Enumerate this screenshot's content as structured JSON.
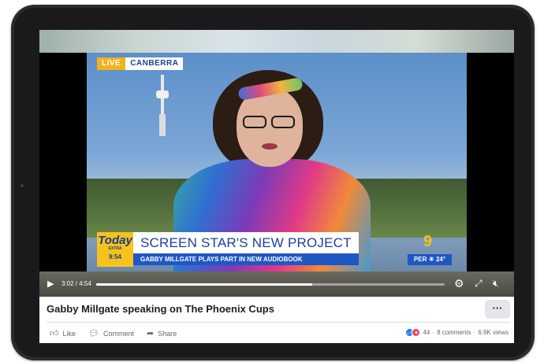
{
  "video": {
    "live_label": "LIVE",
    "location": "CANBERRA",
    "show_logo": "Today",
    "show_logo_sub": "EXTRA",
    "show_time": "9:54",
    "headline": "SCREEN STAR'S NEW PROJECT",
    "subheadline": "GABBY MILLGATE PLAYS PART IN NEW AUDIOBOOK",
    "channel_logo": "9",
    "weather": "PER ☀ 24°",
    "time_display": "3:02 / 4:54",
    "progress": 0.62
  },
  "icons": {
    "play": "play-icon",
    "settings": "gear-icon",
    "fullscreen": "fullscreen-icon",
    "mute": "volume-mute-icon",
    "more": "more-icon",
    "like": "thumbs-up-icon",
    "comment": "comment-icon",
    "share": "share-icon"
  },
  "post": {
    "title": "Gabby Millgate speaking on The Phoenix Cups",
    "more_label": "···",
    "actions": {
      "like": "Like",
      "comment": "Comment",
      "share": "Share"
    },
    "reaction_count": "44",
    "comments": "8 comments",
    "views": "6.9K views",
    "separator": "·"
  },
  "colors": {
    "accent_blue": "#1f57c4",
    "brand_yellow": "#f6c21c",
    "fb_like": "#1877f2",
    "fb_love": "#f33e58"
  }
}
